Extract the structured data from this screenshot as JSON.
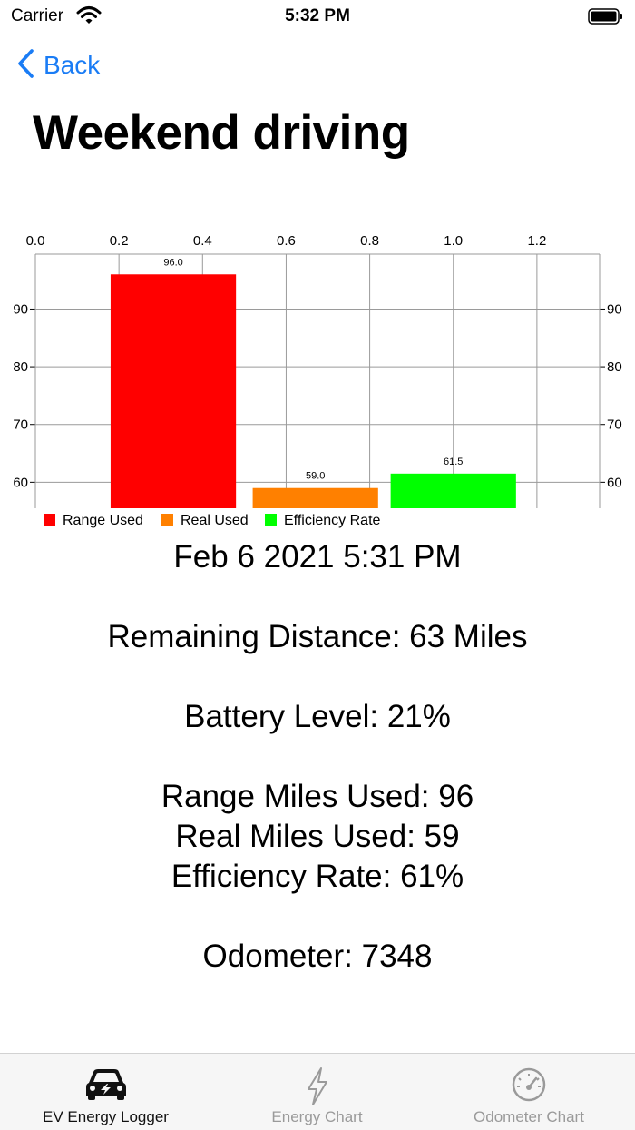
{
  "status_bar": {
    "carrier": "Carrier",
    "time": "5:32 PM"
  },
  "nav": {
    "back_label": "Back"
  },
  "title": "Weekend driving",
  "chart_data": {
    "type": "bar",
    "categories": [
      "Range Used",
      "Real Used",
      "Efficiency Rate"
    ],
    "x": [
      0.33,
      0.67,
      1.0
    ],
    "values": [
      96.0,
      59.0,
      61.5
    ],
    "value_labels": [
      "96.0",
      "59.0",
      "61.5"
    ],
    "colors": [
      "#ff0000",
      "#ff8000",
      "#00ff00"
    ],
    "x_ticks": [
      "0.0",
      "0.2",
      "0.4",
      "0.6",
      "0.8",
      "1.0",
      "1.2"
    ],
    "x_tick_values": [
      0.0,
      0.2,
      0.4,
      0.6,
      0.8,
      1.0,
      1.2
    ],
    "xlim": [
      0.0,
      1.35
    ],
    "y_ticks": [
      "60",
      "70",
      "80",
      "90"
    ],
    "y_tick_values": [
      60,
      70,
      80,
      90
    ],
    "ylim": [
      55.5,
      99.5
    ],
    "legend": [
      "Range Used",
      "Real Used",
      "Efficiency Rate"
    ],
    "legend_position": "bottom-left",
    "grid": true
  },
  "details": {
    "date": "Feb 6 2021 5:31 PM",
    "remaining": "Remaining Distance: 63 Miles",
    "battery": "Battery Level: 21%",
    "range_used": "Range Miles Used: 96",
    "real_used": "Real Miles Used: 59",
    "efficiency": "Efficiency Rate: 61%",
    "odometer": "Odometer: 7348"
  },
  "tabs": [
    {
      "label": "EV Energy Logger",
      "icon": "car-icon",
      "active": true
    },
    {
      "label": "Energy Chart",
      "icon": "bolt-icon",
      "active": false
    },
    {
      "label": "Odometer Chart",
      "icon": "gauge-icon",
      "active": false
    }
  ],
  "colors": {
    "accent": "#1a7cf5",
    "inactive_tab": "#9a9a9a"
  }
}
